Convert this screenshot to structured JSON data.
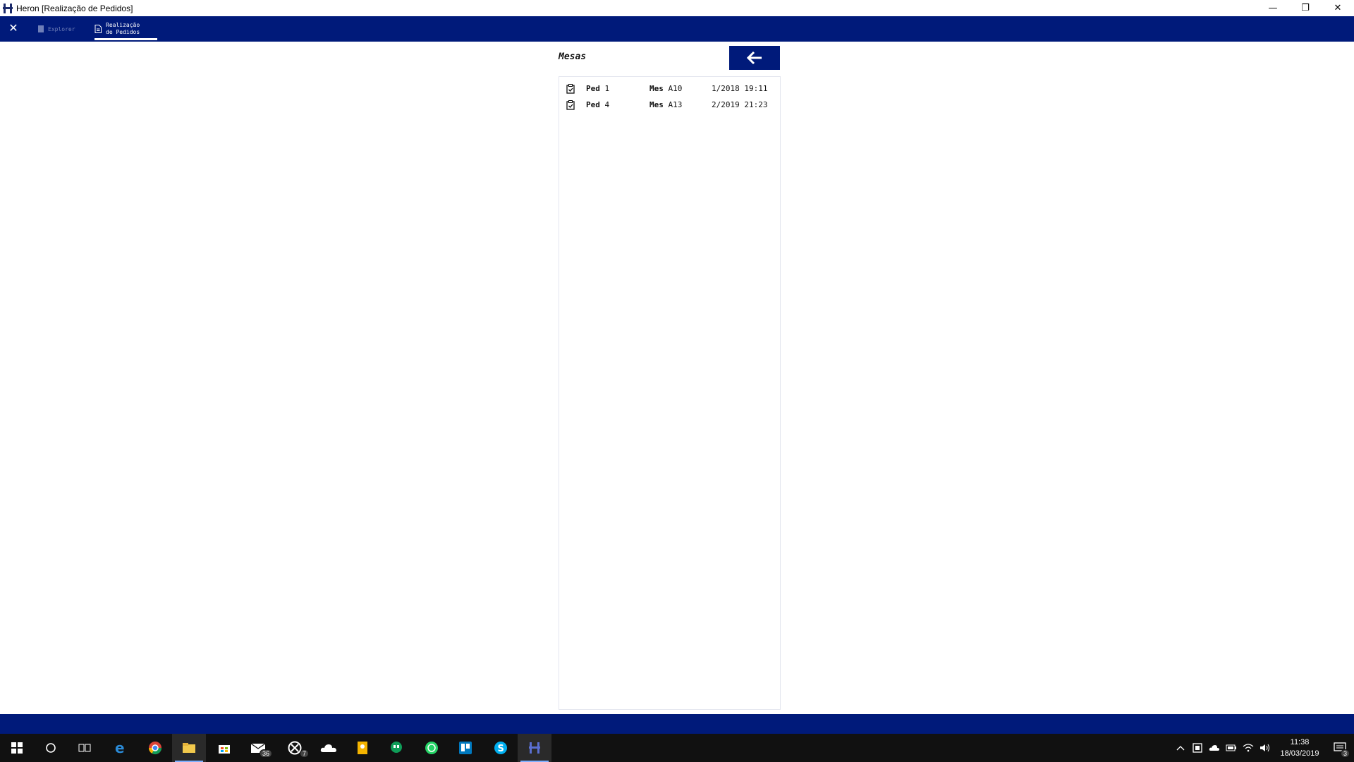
{
  "window": {
    "title": "Heron [Realização de Pedidos]",
    "controls": {
      "minimize": "—",
      "restore": "❐",
      "close": "✕"
    }
  },
  "toolbar": {
    "close_icon": "close-icon",
    "tabs": [
      {
        "label": "Explorer",
        "active": false
      },
      {
        "label": "Realização\nde Pedidos",
        "active": true
      }
    ]
  },
  "page": {
    "heading": "Mesas",
    "back_button_icon": "arrow-left-icon"
  },
  "orders": [
    {
      "ped_label": "Ped",
      "ped_num": "1",
      "mesa_label": "Mes",
      "mesa": "A10",
      "date": "1/2018 19:11"
    },
    {
      "ped_label": "Ped",
      "ped_num": "4",
      "mesa_label": "Mes",
      "mesa": "A13",
      "date": "2/2019 21:23"
    }
  ],
  "taskbar": {
    "badges": {
      "mail": "36",
      "xbox": "7",
      "notifications": "3"
    },
    "clock": {
      "time": "11:38",
      "date": "18/03/2019"
    }
  },
  "colors": {
    "accent": "#001a7a",
    "taskbar": "#111111"
  }
}
